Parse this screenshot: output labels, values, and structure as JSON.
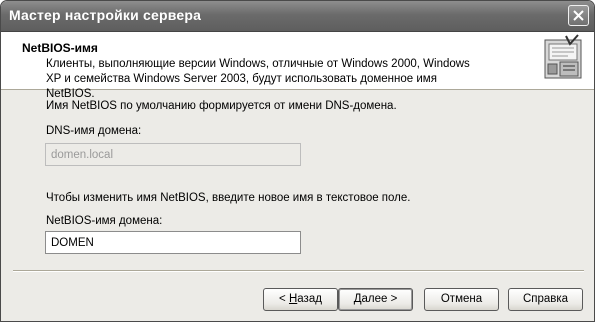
{
  "window": {
    "title": "Мастер настройки сервера"
  },
  "header": {
    "title": "NetBIOS-имя",
    "description": "Клиенты, выполняющие версии Windows, отличные от Windows 2000, Windows XP и семейства Windows Server 2003, будут использовать доменное имя NetBIOS."
  },
  "content": {
    "intro": "Имя NetBIOS по умолчанию формируется от имени DNS-домена.",
    "dns_label": "DNS-имя домена:",
    "dns_value": "domen.local",
    "change_hint": "Чтобы изменить имя NetBIOS, введите новое имя в текстовое поле.",
    "netbios_label": "NetBIOS-имя домена:",
    "netbios_value": "DOMEN"
  },
  "buttons": {
    "back_prefix": "< ",
    "back_key": "Н",
    "back_rest": "азад",
    "next_label": "Далее >",
    "cancel_label": "Отмена",
    "help_label": "Справка"
  }
}
